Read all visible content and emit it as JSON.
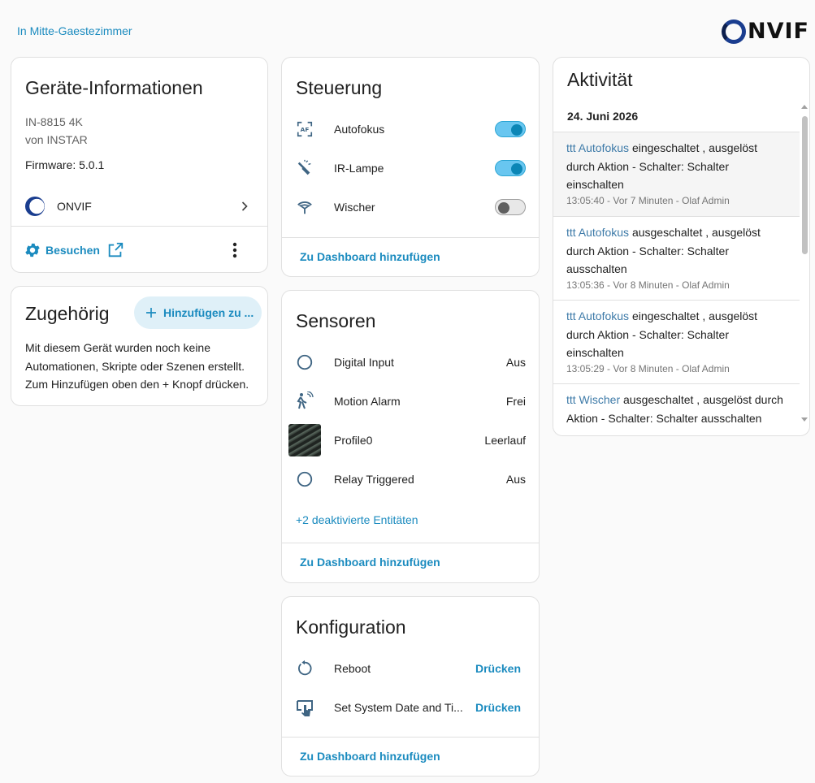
{
  "breadcrumb": "In Mitte-Gaestezimmer",
  "logo_text": "NVIF",
  "device_info": {
    "title": "Geräte-Informationen",
    "model": "IN-8815 4K",
    "manufacturer": "von INSTAR",
    "firmware": "Firmware: 5.0.1",
    "integration": "ONVIF",
    "visit": "Besuchen"
  },
  "related": {
    "title": "Zugehörig",
    "add_button": "Hinzufügen zu ...",
    "text": "Mit diesem Gerät wurden noch keine Automationen, Skripte oder Szenen erstellt. Zum Hinzufügen oben den + Knopf drücken."
  },
  "controls": {
    "title": "Steuerung",
    "items": [
      {
        "label": "Autofokus",
        "on": true
      },
      {
        "label": "IR-Lampe",
        "on": true
      },
      {
        "label": "Wischer",
        "on": false
      }
    ],
    "add_dashboard": "Zu Dashboard hinzufügen"
  },
  "sensors": {
    "title": "Sensoren",
    "items": [
      {
        "label": "Digital Input",
        "value": "Aus"
      },
      {
        "label": "Motion Alarm",
        "value": "Frei"
      },
      {
        "label": "Profile0",
        "value": "Leerlauf"
      },
      {
        "label": "Relay Triggered",
        "value": "Aus"
      }
    ],
    "disabled": "+2 deaktivierte Entitäten",
    "add_dashboard": "Zu Dashboard hinzufügen"
  },
  "config": {
    "title": "Konfiguration",
    "items": [
      {
        "label": "Reboot",
        "action": "Drücken"
      },
      {
        "label": "Set System Date and Ti...",
        "action": "Drücken"
      }
    ],
    "add_dashboard": "Zu Dashboard hinzufügen"
  },
  "activity": {
    "title": "Aktivität",
    "date": "24. Juni 2026",
    "entries": [
      {
        "name": "ttt Autofokus",
        "rest": " eingeschaltet , ausgelöst durch Aktion - Schalter: Schalter einschalten",
        "meta": "13:05:40 - Vor 7 Minuten - Olaf Admin"
      },
      {
        "name": "ttt Autofokus",
        "rest": " ausgeschaltet , ausgelöst durch Aktion - Schalter: Schalter ausschalten",
        "meta": "13:05:36 - Vor 8 Minuten - Olaf Admin"
      },
      {
        "name": "ttt Autofokus",
        "rest": " eingeschaltet , ausgelöst durch Aktion - Schalter: Schalter einschalten",
        "meta": "13:05:29 - Vor 8 Minuten - Olaf Admin"
      },
      {
        "name": "ttt Wischer",
        "rest": " ausgeschaltet , ausgelöst durch Aktion - Schalter: Schalter ausschalten",
        "meta": ""
      }
    ]
  },
  "colors": {
    "accent": "#1b8bbf",
    "toggle_on": "#0b86b6",
    "icon": "#3f6583"
  }
}
